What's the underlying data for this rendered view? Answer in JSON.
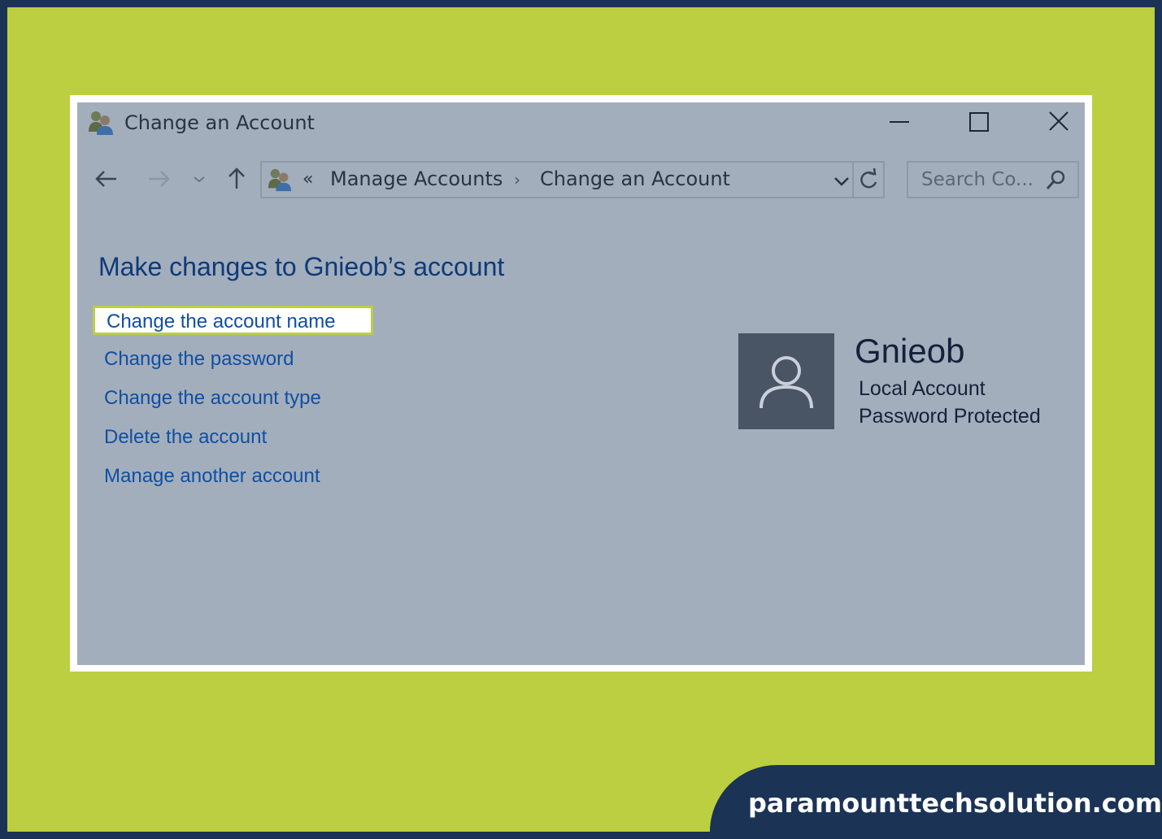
{
  "window": {
    "title": "Change an Account"
  },
  "navigation": {
    "breadcrumb_prefix": "«",
    "breadcrumbs": [
      "Manage Accounts",
      "Change an Account"
    ],
    "breadcrumb_separator": "›",
    "search_placeholder": "Search Co..."
  },
  "main": {
    "heading": "Make changes to Gnieob’s account",
    "links": [
      {
        "label": "Change the account name",
        "highlighted": true
      },
      {
        "label": "Change the password"
      },
      {
        "label": "Change the account type"
      },
      {
        "label": "Delete the account"
      },
      {
        "label": "Manage another account"
      }
    ]
  },
  "user": {
    "name": "Gnieob",
    "account_type": "Local Account",
    "password_status": "Password Protected"
  },
  "branding": {
    "site": "paramounttechsolution.com"
  },
  "colors": {
    "outer_border": "#1b3355",
    "frame": "#bccf40",
    "window_bg": "#a3aebc",
    "link": "#0f4fa3",
    "heading": "#0d3a7a",
    "avatar_bg": "#495464"
  },
  "icons": [
    "users-icon",
    "minimize-icon",
    "maximize-icon",
    "close-icon",
    "back-arrow-icon",
    "forward-arrow-icon",
    "chevron-down-icon",
    "up-arrow-icon",
    "refresh-icon",
    "search-icon",
    "user-avatar-icon"
  ]
}
